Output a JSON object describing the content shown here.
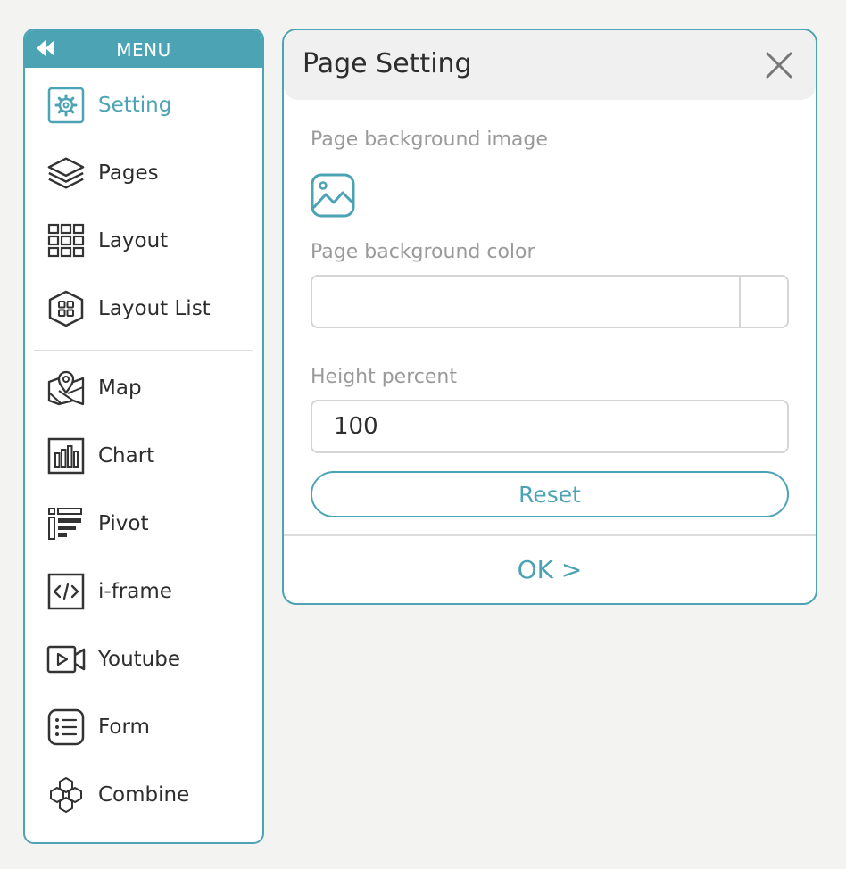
{
  "menu": {
    "title": "MENU",
    "collapse_icon": "double-chevron-left-icon",
    "accent_color": "#4ba3b4",
    "groups": [
      [
        {
          "label": "Setting",
          "icon": "gear-icon",
          "active": true
        },
        {
          "label": "Pages",
          "icon": "layers-icon"
        },
        {
          "label": "Layout",
          "icon": "grid-icon"
        },
        {
          "label": "Layout List",
          "icon": "hexagon-grid-icon"
        }
      ],
      [
        {
          "label": "Map",
          "icon": "map-pin-icon"
        },
        {
          "label": "Chart",
          "icon": "bar-chart-icon"
        },
        {
          "label": "Pivot",
          "icon": "pivot-icon"
        },
        {
          "label": "i-frame",
          "icon": "code-icon"
        },
        {
          "label": "Youtube",
          "icon": "video-camera-icon"
        },
        {
          "label": "Form",
          "icon": "form-list-icon"
        },
        {
          "label": "Combine",
          "icon": "hexagon-cluster-icon"
        }
      ]
    ]
  },
  "dialog": {
    "title": "Page Setting",
    "close_icon": "close-icon",
    "bg_image_label": "Page background image",
    "bg_image_icon": "image-icon",
    "bg_color_label": "Page background color",
    "bg_color_value": "",
    "height_label": "Height percent",
    "height_value": "100",
    "reset_label": "Reset",
    "ok_label": "OK >"
  }
}
